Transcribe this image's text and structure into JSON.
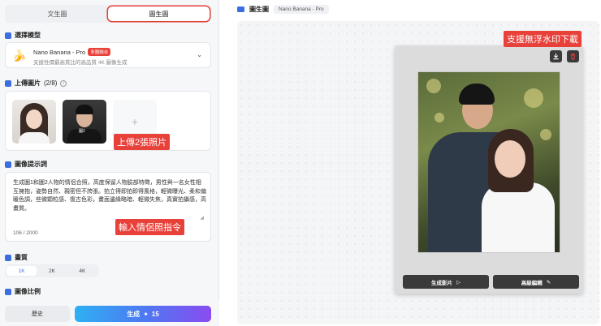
{
  "tabs": [
    {
      "label": "文生圖",
      "active": false
    },
    {
      "label": "圖生圖",
      "active": true
    }
  ],
  "model": {
    "section_title": "選擇模型",
    "name": "Nano Banana - Pro",
    "badge": "多圖融合",
    "description": "支援性價最高質比的高品質 4K 圖像生成",
    "icon": "banana-icon"
  },
  "upload": {
    "section_title": "上傳圖片",
    "count": "(2/8)",
    "photo2_tag": "圖2",
    "add_symbol": "+"
  },
  "prompt": {
    "section_title": "圖像提示詞",
    "text": "生成圖1和圖2人物的情侶合照，高度保留人物臉部特徵，男性與一名女性相互擁抱，姿勢自然、親密但不誇張。拍立得即拍即得風格，輕微曝光、柔和偏暖色調，些微顆粒感、復古色彩，畫面邊緣略暗、輕微失焦，真實拍攝感，高畫質。",
    "counter": "106 / 2000"
  },
  "quality": {
    "section_title": "畫質",
    "options": [
      {
        "label": "1K",
        "active": true
      },
      {
        "label": "2K",
        "active": false
      },
      {
        "label": "4K",
        "active": false
      }
    ]
  },
  "aspect": {
    "section_title": "圖像比例"
  },
  "footer": {
    "history_label": "歷史",
    "generate_label": "生成",
    "generate_cost": "15"
  },
  "annotations": {
    "upload_hint": "上傳2張照片",
    "prompt_hint": "輸入情侶照指令",
    "download_hint": "支援無浮水印下載"
  },
  "right": {
    "title": "圖生圖",
    "model_chip": "Nano Banana - Pro",
    "actions": {
      "video_label": "生成影片",
      "edit_label": "高級編輯"
    }
  },
  "colors": {
    "accent_blue": "#3b6fe0",
    "annotation_red": "#e8413a",
    "generate_gradient_start": "#2fb0f3",
    "generate_gradient_end": "#8a4cf0"
  }
}
